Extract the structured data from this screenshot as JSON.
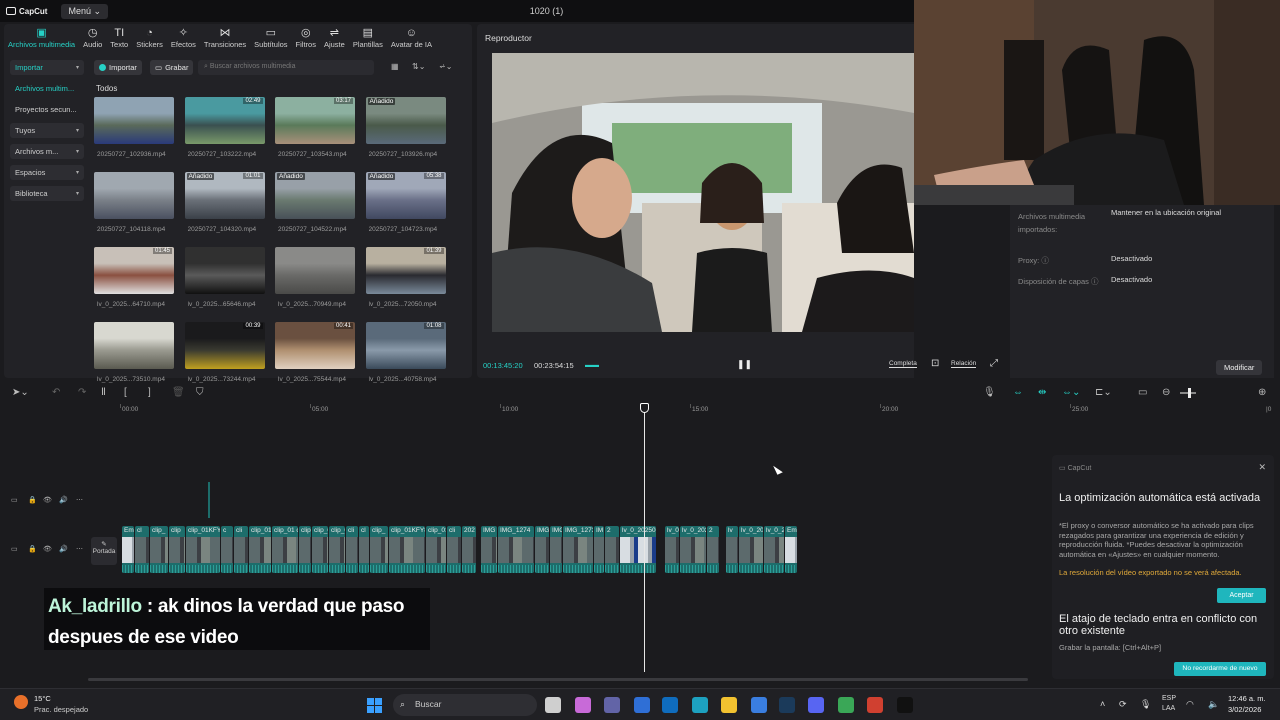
{
  "app": {
    "brand": "CapCut",
    "menu_label": "Menú",
    "project_title": "1020 (1)"
  },
  "toolbar_tabs": [
    {
      "label": "Archivos multimedia",
      "icon": "media-icon",
      "glyph": "▣",
      "active": true
    },
    {
      "label": "Audio",
      "icon": "audio-icon",
      "glyph": "◷"
    },
    {
      "label": "Texto",
      "icon": "text-icon",
      "glyph": "TI"
    },
    {
      "label": "Stickers",
      "icon": "sticker-icon",
      "glyph": "◔"
    },
    {
      "label": "Efectos",
      "icon": "effects-icon",
      "glyph": "✧"
    },
    {
      "label": "Transiciones",
      "icon": "transitions-icon",
      "glyph": "⋈"
    },
    {
      "label": "Subtítulos",
      "icon": "subtitles-icon",
      "glyph": "▭"
    },
    {
      "label": "Filtros",
      "icon": "filters-icon",
      "glyph": "◎"
    },
    {
      "label": "Ajuste",
      "icon": "adjust-icon",
      "glyph": "⇌"
    },
    {
      "label": "Plantillas",
      "icon": "templates-icon",
      "glyph": "▤"
    },
    {
      "label": "Avatar de IA",
      "icon": "ai-avatar-icon",
      "glyph": "☺"
    }
  ],
  "side_nav": [
    {
      "label": "Importar",
      "box": true,
      "active": true,
      "chevron": true
    },
    {
      "label": "Archivos multim...",
      "box": false,
      "active": true
    },
    {
      "label": "Proyectos secun...",
      "box": false
    },
    {
      "label": "Tuyos",
      "box": true,
      "chevron": true
    },
    {
      "label": "Archivos m...",
      "box": true,
      "chevron": true
    },
    {
      "label": "Espacios",
      "box": true,
      "chevron": true
    },
    {
      "label": "Biblioteca",
      "box": true,
      "chevron": true
    }
  ],
  "media": {
    "import_label": "Importar",
    "record_label": "Grabar",
    "search_placeholder": "Buscar archivos multimedia",
    "all_label": "Todos",
    "added_label": "Añadido",
    "items": [
      {
        "name": "20250727_102936.mp4",
        "duration": "",
        "added": false,
        "colors": [
          "#8fa3b3",
          "#5a6a5a",
          "#2a3a7a"
        ]
      },
      {
        "name": "20250727_103222.mp4",
        "duration": "02:49",
        "added": false,
        "colors": [
          "#4a9aa0",
          "#3a5050",
          "#7a9a6a"
        ]
      },
      {
        "name": "20250727_103543.mp4",
        "duration": "03:17",
        "added": false,
        "colors": [
          "#8cb0a0",
          "#5a7a5a",
          "#a8907a"
        ]
      },
      {
        "name": "20250727_103926.mp4",
        "duration": "",
        "added": true,
        "colors": [
          "#7a8a80",
          "#4a5a4a",
          "#5a6a7a"
        ]
      },
      {
        "name": "20250727_104118.mp4",
        "duration": "",
        "added": false,
        "colors": [
          "#a0a8b0",
          "#7a8088",
          "#4a5060"
        ]
      },
      {
        "name": "20250727_104320.mp4",
        "duration": "01:01",
        "added": true,
        "colors": [
          "#b0b8c0",
          "#6a7078",
          "#3a4048"
        ]
      },
      {
        "name": "20250727_104522.mp4",
        "duration": "",
        "added": true,
        "colors": [
          "#98a0a8",
          "#6a7a70",
          "#485058"
        ]
      },
      {
        "name": "20250727_104723.mp4",
        "duration": "05:38",
        "added": true,
        "colors": [
          "#a0a8b8",
          "#6a7088",
          "#404860"
        ]
      },
      {
        "name": "lv_0_2025...64710.mp4",
        "duration": "01:45",
        "added": false,
        "colors": [
          "#c8c0b8",
          "#8a5040",
          "#e0e0e0"
        ]
      },
      {
        "name": "lv_0_2025...65646.mp4",
        "duration": "",
        "added": false,
        "colors": [
          "#303030",
          "#5a5a5a",
          "#101010"
        ]
      },
      {
        "name": "lv_0_2025...70949.mp4",
        "duration": "",
        "added": false,
        "colors": [
          "#8a8a88",
          "#6a6a68",
          "#4a4a48"
        ]
      },
      {
        "name": "lv_0_2025...72050.mp4",
        "duration": "01:39",
        "added": false,
        "colors": [
          "#b8b0a0",
          "#2a2a30",
          "#7a8a9a"
        ]
      },
      {
        "name": "lv_0_2025...73510.mp4",
        "duration": "",
        "added": false,
        "colors": [
          "#d8d8d0",
          "#9a9a90",
          "#5a5a50"
        ]
      },
      {
        "name": "lv_0_2025...73244.mp4",
        "duration": "00:39",
        "added": false,
        "colors": [
          "#1a1a1c",
          "#3a3a30",
          "#c0a020"
        ]
      },
      {
        "name": "lv_0_2025...75544.mp4",
        "duration": "00:41",
        "added": false,
        "colors": [
          "#6a5040",
          "#b09070",
          "#e0d0c0"
        ]
      },
      {
        "name": "lv_0_2025...40758.mp4",
        "duration": "01:08",
        "added": false,
        "colors": [
          "#5a6a7a",
          "#8a9aaa",
          "#3a4a5a"
        ]
      }
    ]
  },
  "player": {
    "title": "Reproductor",
    "time_current": "00:13:45:20",
    "time_total": "00:23:54:15",
    "full_label": "Completa",
    "ratio_label": "Relación"
  },
  "properties": {
    "rows": [
      {
        "label": "Archivos multimedia importados:",
        "value": "Mantener en la ubicación original"
      },
      {
        "label": "Proxy: ⓘ",
        "value": "Desactivado"
      },
      {
        "label": "Disposición de capas ⓘ",
        "value": "Desactivado"
      }
    ],
    "modify_label": "Modificar"
  },
  "timeline": {
    "ruler": [
      "00:00",
      "05:00",
      "10:00",
      "15:00",
      "20:00",
      "25:00"
    ],
    "cover_label": "Portada",
    "clips": [
      {
        "label": "Em",
        "white": true
      },
      {
        "label": "cl"
      },
      {
        "label": "clip_"
      },
      {
        "label": "clip"
      },
      {
        "label": "clip_01KFY"
      },
      {
        "label": "c"
      },
      {
        "label": "cli"
      },
      {
        "label": "clip_01"
      },
      {
        "label": "clip_01 cli"
      },
      {
        "label": "clip"
      },
      {
        "label": "clip_0"
      },
      {
        "label": "clip_0"
      },
      {
        "label": "cli"
      },
      {
        "label": "cl"
      },
      {
        "label": "clip_"
      },
      {
        "label": "clip_01KFY8"
      },
      {
        "label": "clip_01"
      },
      {
        "label": "cli"
      },
      {
        "label": "202"
      },
      {
        "label": "IMG"
      },
      {
        "label": "IMG_1274"
      },
      {
        "label": "IMG_1"
      },
      {
        "label": "IMG"
      },
      {
        "label": "IMG_1273"
      },
      {
        "label": "IM"
      },
      {
        "label": "2"
      },
      {
        "label": "lv_0_20250",
        "white": true
      },
      {
        "label": "lv_0"
      },
      {
        "label": "lv_0_2025"
      },
      {
        "label": "2"
      },
      {
        "label": "lv"
      },
      {
        "label": "lv_0_2025"
      },
      {
        "label": "lv_0_202"
      },
      {
        "label": "Em",
        "white": true
      }
    ]
  },
  "chat": {
    "user": "Ak_ladrillo",
    "message": " : ak dinos la verdad que paso despues de ese video"
  },
  "notification": {
    "brand": "CapCut",
    "title1": "La optimización automática está activada",
    "body1": "*El proxy o conversor automático se ha activado para clips rezagados para garantizar una experiencia de edición y reproducción fluida. *Puedes desactivar la optimización automática en «Ajustes» en cualquier momento.",
    "warning": "La resolución del vídeo exportado no se verá afectada.",
    "accept_label": "Aceptar",
    "title2": "El atajo de teclado entra en conflicto con otro existente",
    "body2": "Grabar la pantalla: [Ctrl+Alt+P]",
    "noremind_label": "No recordarme de nuevo"
  },
  "taskbar": {
    "temp": "15°C",
    "weather": "Prac. despejado",
    "search_placeholder": "Buscar",
    "lang1": "ESP",
    "lang2": "LAA",
    "time": "12:46 a. m.",
    "date": "3/02/2026",
    "apps": [
      {
        "icon": "task-view-icon",
        "color": "#cfcfcf"
      },
      {
        "icon": "copilot-icon",
        "color": "#c86ad8"
      },
      {
        "icon": "teams-icon",
        "color": "#6264a7"
      },
      {
        "icon": "store-icon",
        "color": "#2f6fd6"
      },
      {
        "icon": "outlook-icon",
        "color": "#0f6cbd"
      },
      {
        "icon": "edge-icon",
        "color": "#1da1c0"
      },
      {
        "icon": "explorer-icon",
        "color": "#f2c230"
      },
      {
        "icon": "bing-icon",
        "color": "#3a7ee0"
      },
      {
        "icon": "steam-icon",
        "color": "#1b3a5a"
      },
      {
        "icon": "discord-icon",
        "color": "#5865f2"
      },
      {
        "icon": "chrome-icon",
        "color": "#3aa757"
      },
      {
        "icon": "chrome-alt-icon",
        "color": "#d04030"
      },
      {
        "icon": "capcut-icon",
        "color": "#111111"
      }
    ]
  },
  "colors": {
    "accent": "#26d1c6",
    "clip": "#1d6d6b",
    "button": "#1fb6bd"
  }
}
